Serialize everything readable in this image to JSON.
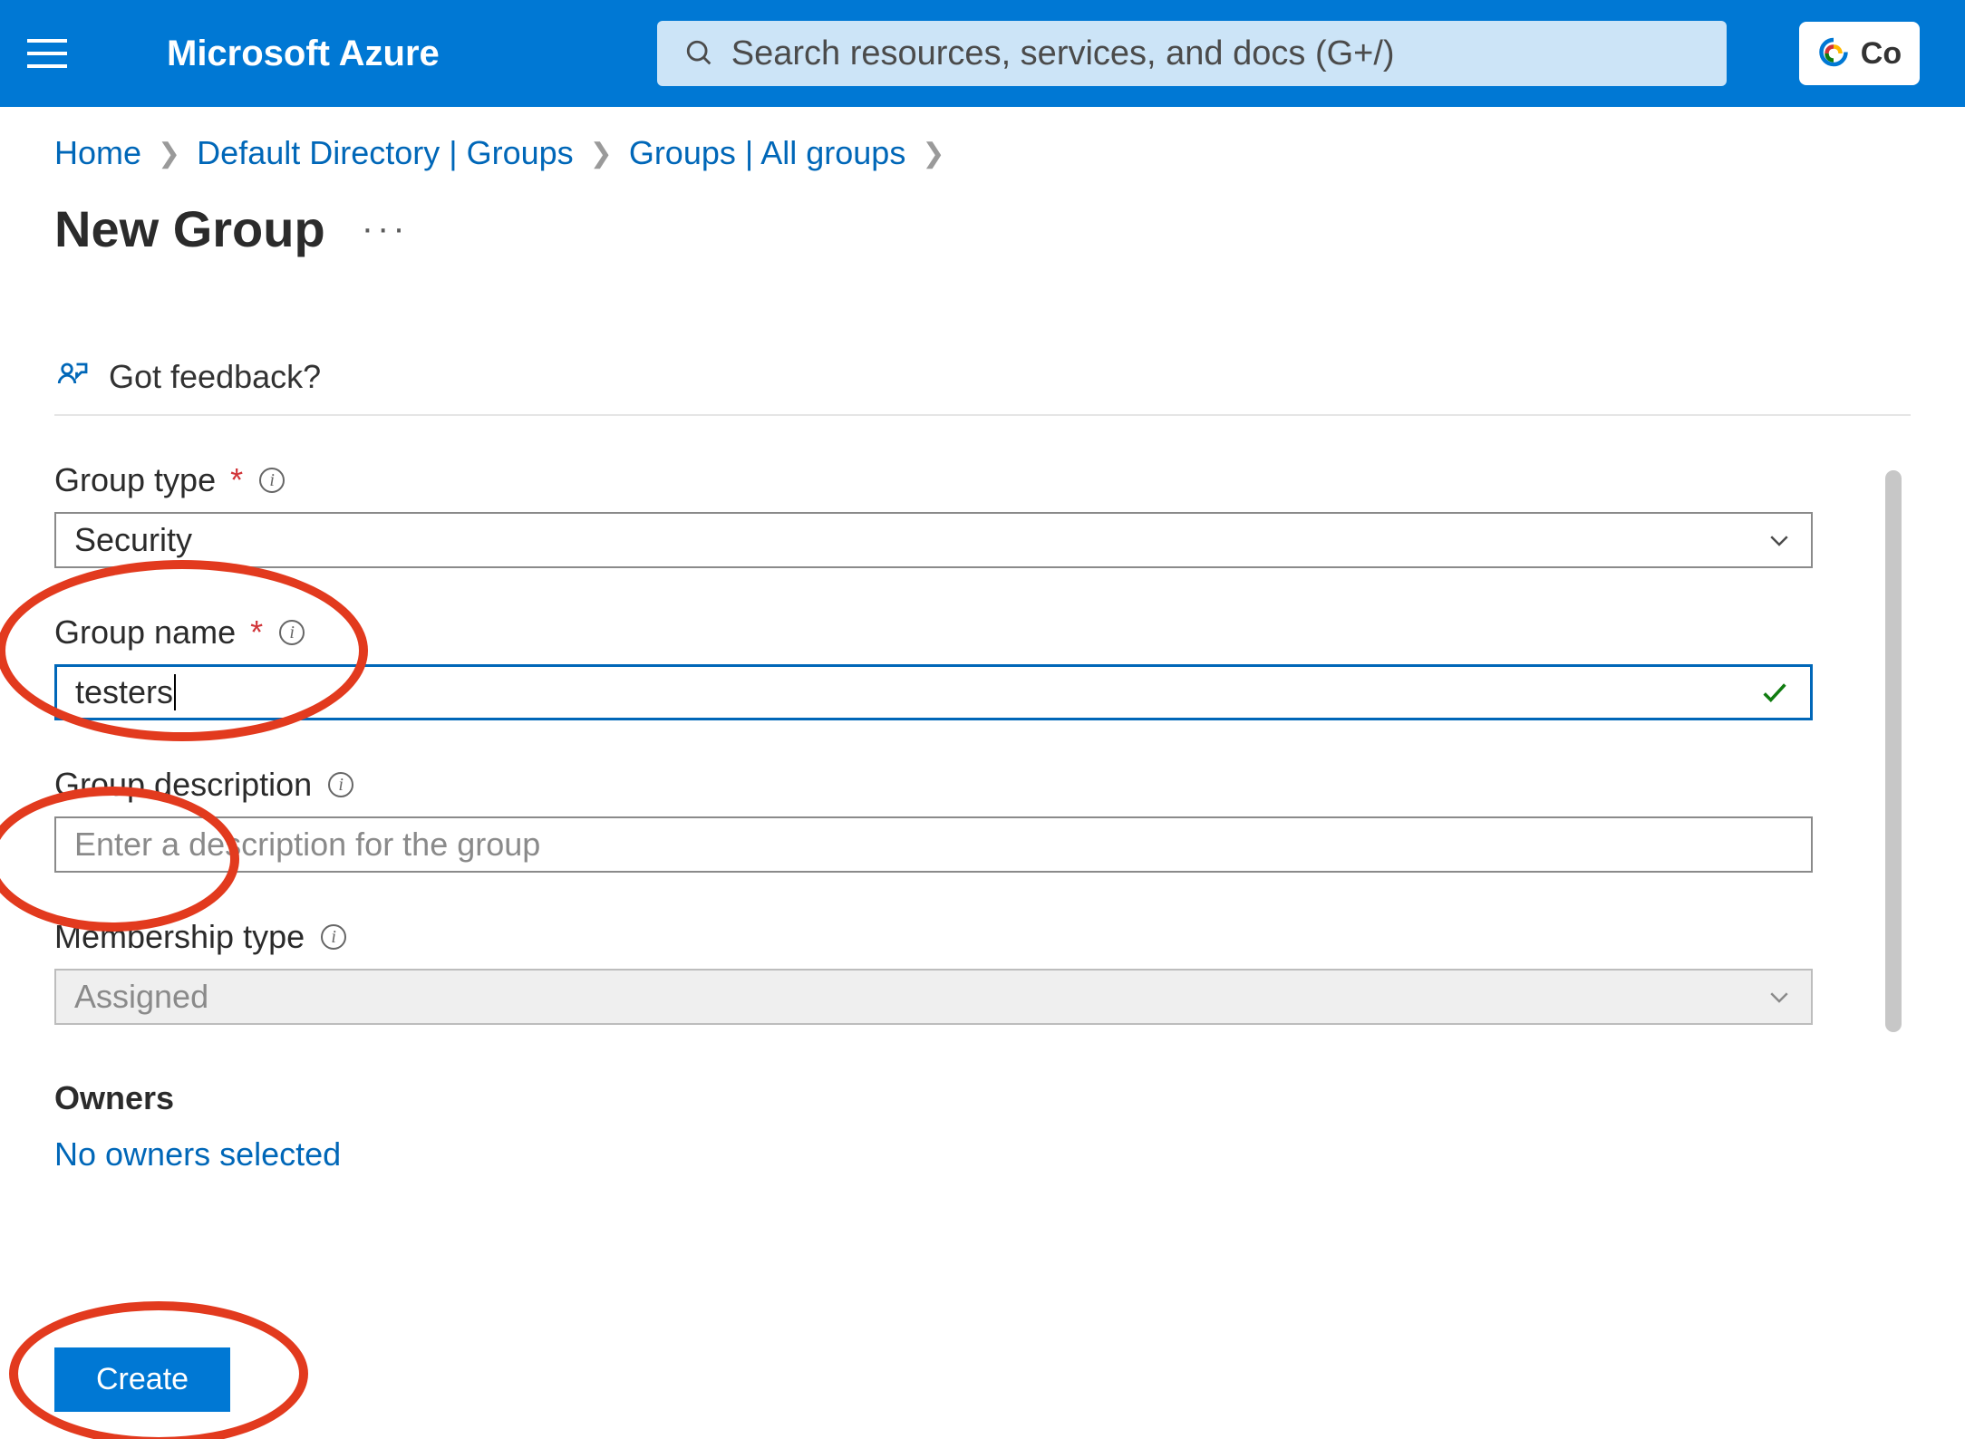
{
  "header": {
    "brand": "Microsoft Azure",
    "search_placeholder": "Search resources, services, and docs (G+/)",
    "copilot_label": "Co"
  },
  "breadcrumb": {
    "items": [
      "Home",
      "Default Directory | Groups",
      "Groups | All groups"
    ]
  },
  "page": {
    "title": "New Group"
  },
  "cmdbar": {
    "feedback": "Got feedback?"
  },
  "form": {
    "group_type": {
      "label": "Group type",
      "value": "Security"
    },
    "group_name": {
      "label": "Group name",
      "value": "testers"
    },
    "group_description": {
      "label": "Group description",
      "placeholder": "Enter a description for the group",
      "value": ""
    },
    "membership_type": {
      "label": "Membership type",
      "value": "Assigned"
    },
    "owners": {
      "heading": "Owners",
      "link": "No owners selected"
    }
  },
  "footer": {
    "create": "Create"
  }
}
